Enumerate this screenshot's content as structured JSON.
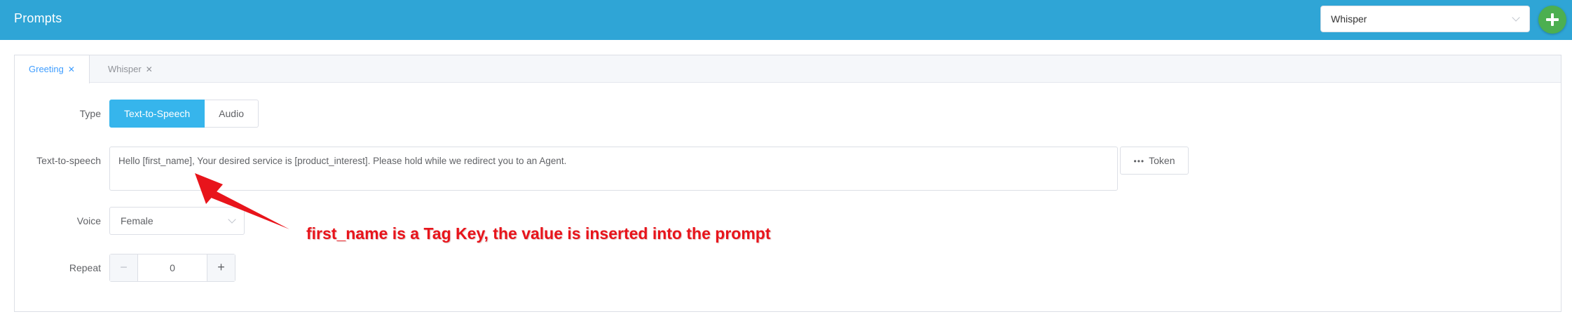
{
  "header": {
    "title": "Prompts",
    "prompt_select": "Whisper",
    "add_icon": "plus-icon"
  },
  "tabs": [
    {
      "label": "Greeting",
      "active": true
    },
    {
      "label": "Whisper",
      "active": false
    }
  ],
  "form": {
    "type_label": "Type",
    "type_options": [
      "Text-to-Speech",
      "Audio"
    ],
    "type_selected": "Text-to-Speech",
    "tts_label": "Text-to-speech",
    "tts_value": "Hello [first_name], Your desired service is [product_interest]. Please hold while we redirect you to an Agent.",
    "token_button": "Token",
    "voice_label": "Voice",
    "voice_value": "Female",
    "repeat_label": "Repeat",
    "repeat_value": "0"
  },
  "annotation": {
    "text": "first_name is a Tag Key, the value is inserted into the prompt",
    "color": "#e8141b"
  },
  "colors": {
    "header": "#2fa5d6",
    "accent": "#36b5ec",
    "add_button": "#4caf50"
  }
}
